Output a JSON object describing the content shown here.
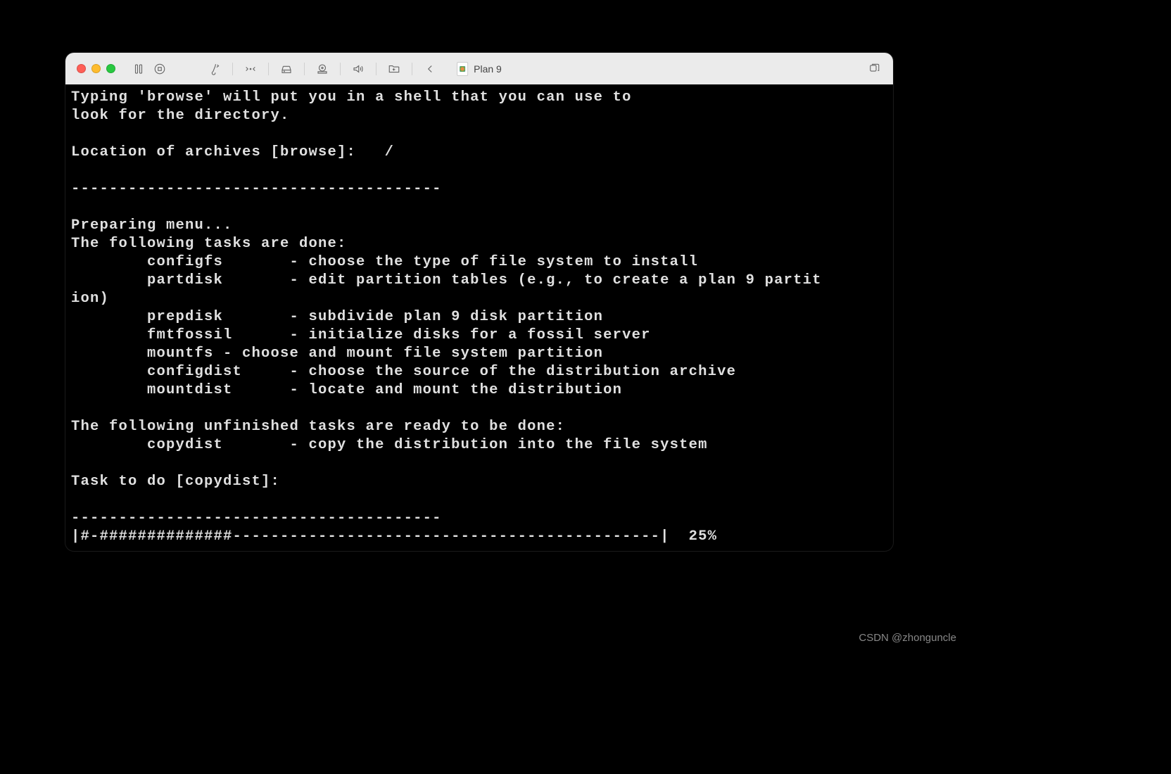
{
  "window": {
    "title": "Plan 9"
  },
  "terminal": {
    "lines": [
      "Typing 'browse' will put you in a shell that you can use to",
      "look for the directory.",
      "",
      "Location of archives [browse]:   /",
      "",
      "---------------------------------------",
      "",
      "Preparing menu...",
      "The following tasks are done:",
      "        configfs       - choose the type of file system to install",
      "        partdisk       - edit partition tables (e.g., to create a plan 9 partit",
      "ion)",
      "        prepdisk       - subdivide plan 9 disk partition",
      "        fmtfossil      - initialize disks for a fossil server",
      "        mountfs - choose and mount file system partition",
      "        configdist     - choose the source of the distribution archive",
      "        mountdist      - locate and mount the distribution",
      "",
      "The following unfinished tasks are ready to be done:",
      "        copydist       - copy the distribution into the file system",
      "",
      "Task to do [copydist]: ",
      "",
      "---------------------------------------",
      "|#-##############---------------------------------------------|  25%"
    ]
  },
  "watermark": "CSDN @zhonguncle"
}
